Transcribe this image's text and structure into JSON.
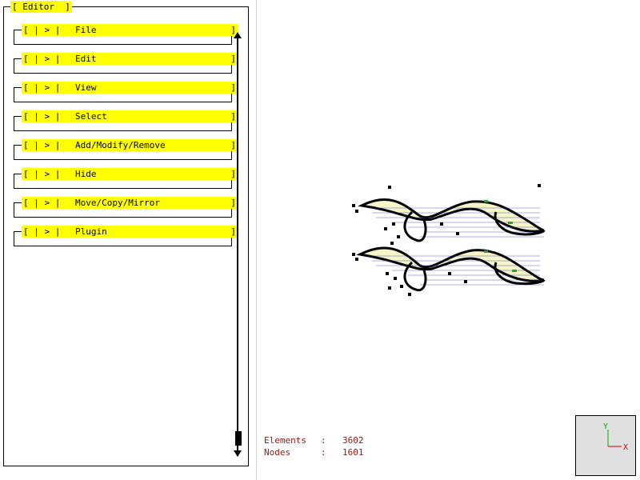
{
  "editor": {
    "title": "[ Editor  ]",
    "items": [
      {
        "prefix": "[ | > |",
        "label": "File",
        "suffix": "]"
      },
      {
        "prefix": "[ | > |",
        "label": "Edit",
        "suffix": "]"
      },
      {
        "prefix": "[ | > |",
        "label": "View",
        "suffix": "]"
      },
      {
        "prefix": "[ | > |",
        "label": "Select",
        "suffix": "]"
      },
      {
        "prefix": "[ | > |",
        "label": "Add/Modify/Remove",
        "suffix": "]"
      },
      {
        "prefix": "[ | > |",
        "label": "Hide",
        "suffix": "]"
      },
      {
        "prefix": "[ | > |",
        "label": "Move/Copy/Mirror",
        "suffix": "]"
      },
      {
        "prefix": "[ | > |",
        "label": "Plugin",
        "suffix": "]"
      }
    ]
  },
  "stats": {
    "elements_label": "Elements",
    "elements_sep": ":",
    "elements_value": "3602",
    "nodes_label": "Nodes",
    "nodes_sep": ":",
    "nodes_value": "1601"
  },
  "axis": {
    "y_label": "Y",
    "x_label": "X"
  },
  "colors": {
    "menu_bg": "#ffff00",
    "stats_text": "#8b1a1a",
    "axis_y": "#00b000",
    "axis_x": "#e00000",
    "mesh_fill": "#f5f5c8",
    "mesh_lines": "#3333cc"
  }
}
